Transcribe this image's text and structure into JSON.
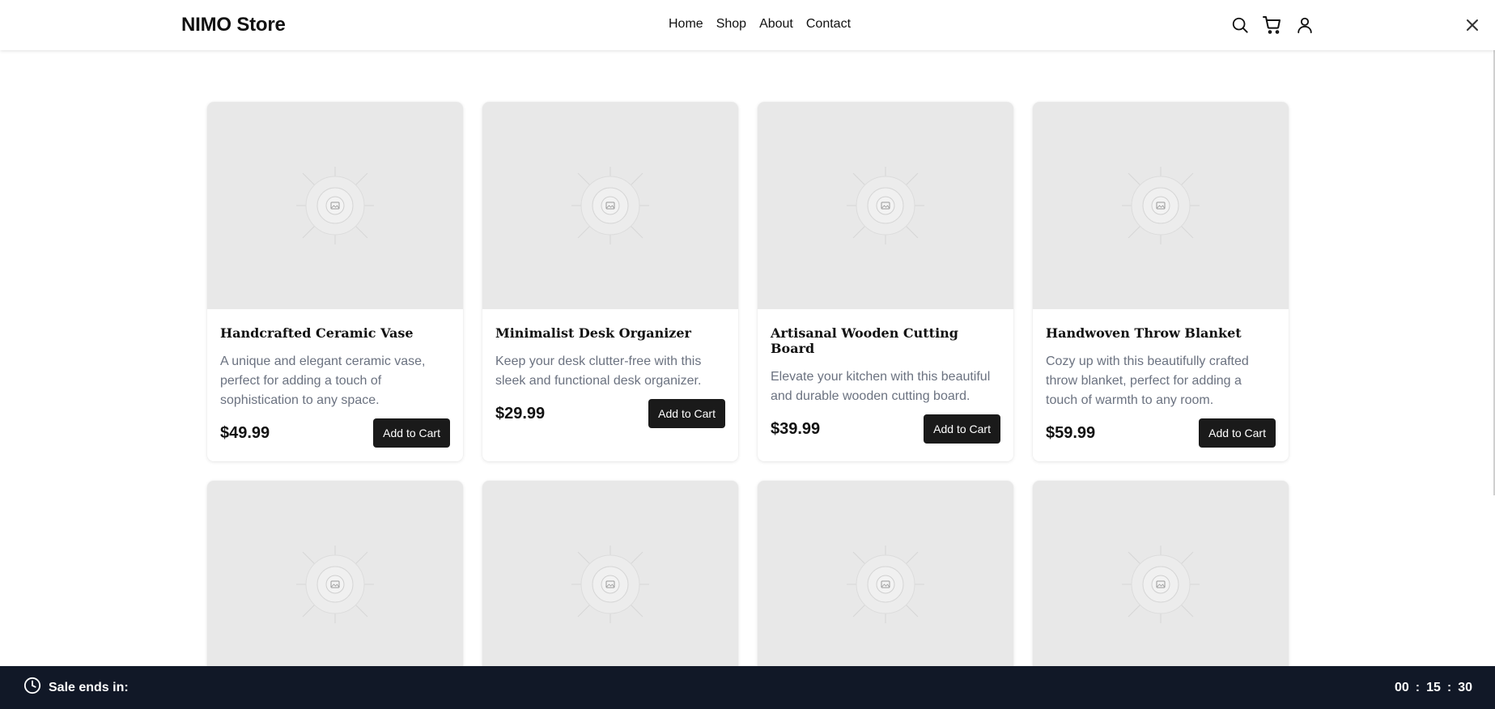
{
  "header": {
    "brand": "NIMO Store",
    "nav": [
      "Home",
      "Shop",
      "About",
      "Contact"
    ],
    "icons": [
      "search-icon",
      "cart-icon",
      "user-icon"
    ],
    "close_icon": "close-icon"
  },
  "products": [
    {
      "title": "Handcrafted Ceramic Vase",
      "description": "A unique and elegant ceramic vase, perfect for adding a touch of sophistication to any space.",
      "price": "$49.99",
      "button": "Add to Cart"
    },
    {
      "title": "Minimalist Desk Organizer",
      "description": "Keep your desk clutter-free with this sleek and functional desk organizer.",
      "price": "$29.99",
      "button": "Add to Cart"
    },
    {
      "title": "Artisanal Wooden Cutting Board",
      "description": "Elevate your kitchen with this beautiful and durable wooden cutting board.",
      "price": "$39.99",
      "button": "Add to Cart"
    },
    {
      "title": "Handwoven Throw Blanket",
      "description": "Cozy up with this beautifully crafted throw blanket, perfect for adding a touch of warmth to any room.",
      "price": "$59.99",
      "button": "Add to Cart"
    }
  ],
  "sale_bar": {
    "label": "Sale ends in:",
    "hours": "00",
    "minutes": "15",
    "seconds": "30",
    "separator": ":",
    "icon": "clock-icon"
  },
  "colors": {
    "sale_bar_bg": "#111827",
    "button_bg": "#1a1a1a",
    "image_placeholder": "#e8e8e8",
    "description_text": "#6b7280"
  }
}
